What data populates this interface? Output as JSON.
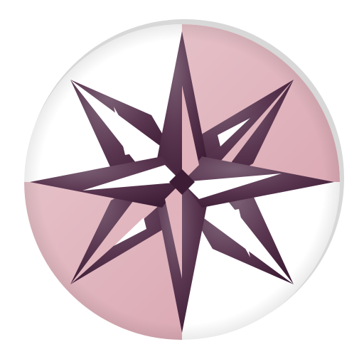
{
  "icon": {
    "name": "compass-rose-app-icon",
    "colors": {
      "background": "#ffffff",
      "disc_white": "#ffffff",
      "disc_pink": "#e1b3bc",
      "star_light": "#7a5f74",
      "star_dark": "#3d1c35",
      "star_mid": "#5a3650",
      "rim_shadow": "#cfcfcf"
    }
  }
}
